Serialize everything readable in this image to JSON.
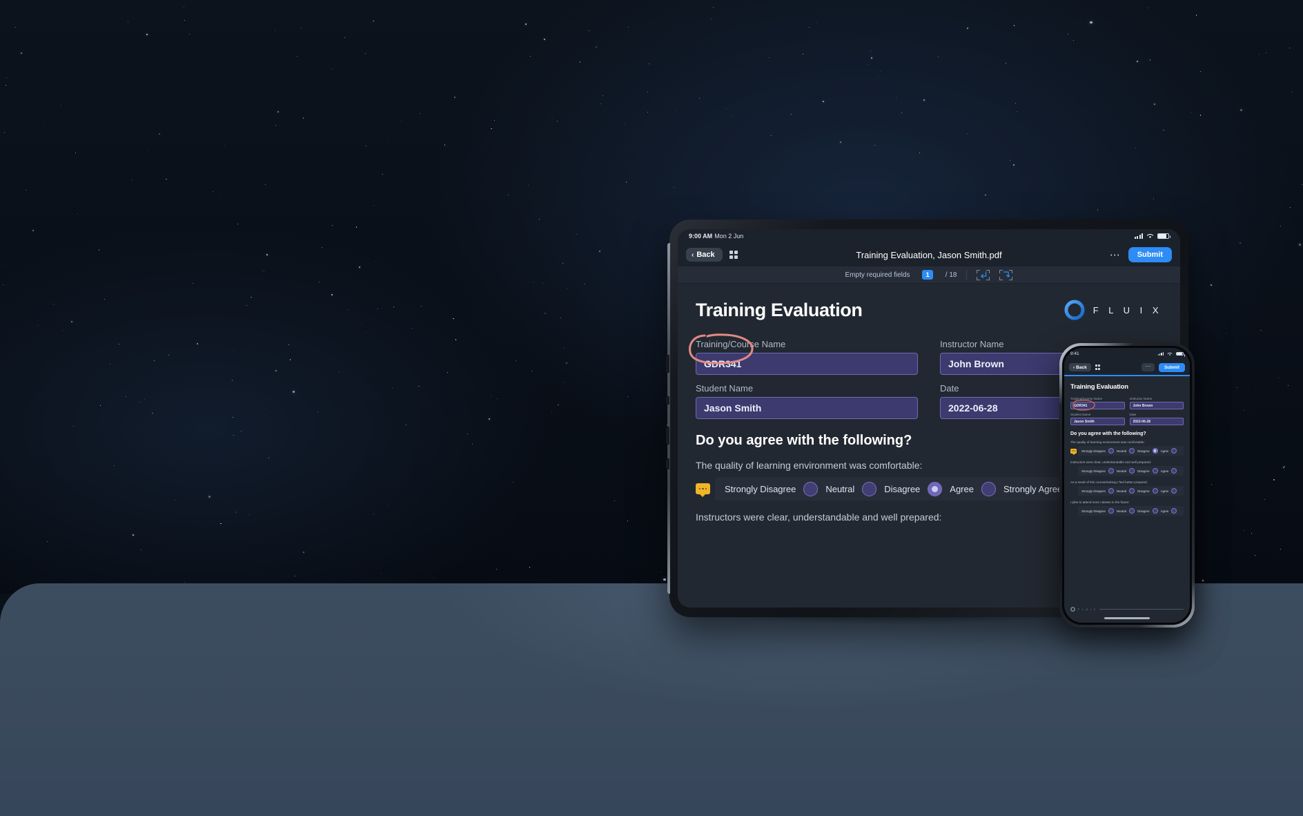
{
  "scene": {
    "background_sky_color": "#0a1019",
    "ground_color": "#3d4d60"
  },
  "tablet": {
    "status_bar": {
      "time": "9:00 AM",
      "date": "Mon 2 Jun",
      "wifi_icon": "wifi-icon",
      "signal_icon": "cellular-signal-icon",
      "battery_icon": "battery-icon"
    },
    "toolbar": {
      "back_label": "Back",
      "back_chevron_icon": "chevron-left-icon",
      "thumbnails_icon": "grid-thumbnails-icon",
      "title": "Training Evaluation, Jason Smith.pdf",
      "more_icon": "more-horizontal-icon",
      "submit_label": "Submit",
      "submit_color": "#2d8cf5"
    },
    "subbar": {
      "required_label": "Empty required fields",
      "required_count": "1",
      "required_total": "/ 18",
      "prev_field_icon": "previous-field-icon",
      "next_field_icon": "next-field-icon"
    },
    "document": {
      "title": "Training Evaluation",
      "brand_name": "F L U I X",
      "brand_logo_icon": "fluix-ring-logo-icon",
      "fields": [
        {
          "label": "Training/Course Name",
          "value": "GDR341",
          "annotated": "true"
        },
        {
          "label": "Instructor Name",
          "value": "John Brown",
          "annotated": "false"
        },
        {
          "label": "Student Name",
          "value": "Jason Smith",
          "annotated": "false"
        },
        {
          "label": "Date",
          "value": "2022-06-28",
          "annotated": "false"
        }
      ],
      "section_title": "Do you agree with the following?",
      "questions": [
        {
          "text": "The quality of learning environment was comfortable:",
          "has_comment": "true",
          "comment_icon": "comment-bubble-icon",
          "selected": "Disagree"
        },
        {
          "text": "Instructors were clear, understandable and well prepared:",
          "has_comment": "false",
          "selected": ""
        }
      ],
      "scale_options": [
        "Strongly Disagree",
        "Neutral",
        "Disagree",
        "Agree",
        "Strongly Agree"
      ],
      "annotation": {
        "type": "hand-drawn-ellipse",
        "color": "#e08a84",
        "target": "GDR341"
      }
    }
  },
  "phone": {
    "status_bar": {
      "time": "9:41",
      "wifi_icon": "wifi-icon",
      "signal_icon": "cellular-signal-icon",
      "battery_icon": "battery-icon"
    },
    "toolbar": {
      "back_label": "Back",
      "back_chevron_icon": "chevron-left-icon",
      "thumbnails_icon": "grid-thumbnails-icon",
      "more_icon": "more-horizontal-icon",
      "submit_label": "Submit"
    },
    "document": {
      "title": "Training Evaluation",
      "fields": [
        {
          "label": "Training/Course Name",
          "value": "GDR341"
        },
        {
          "label": "Instructor Name",
          "value": "John Brown"
        },
        {
          "label": "Student Name",
          "value": "Jason Smith"
        },
        {
          "label": "Date",
          "value": "2022-06-28"
        }
      ],
      "section_title": "Do you agree with the following?",
      "questions": [
        {
          "text": "The quality of learning environment was comfortable:",
          "has_comment": "true",
          "selected": "Disagree"
        },
        {
          "text": "Instructors were clear, understandable and well prepared:",
          "has_comment": "false",
          "selected": ""
        },
        {
          "text": "As a result of this course/training I feel better prepared:",
          "has_comment": "false",
          "selected": ""
        },
        {
          "text": "I plan to attend more classes in the future:",
          "has_comment": "false",
          "selected": ""
        }
      ],
      "scale_options": [
        "Strongly Disagree",
        "Neutral",
        "Disagree",
        "Agree"
      ],
      "footer_brand": "F L U I X",
      "footer_logo_icon": "fluix-ring-logo-icon"
    }
  }
}
